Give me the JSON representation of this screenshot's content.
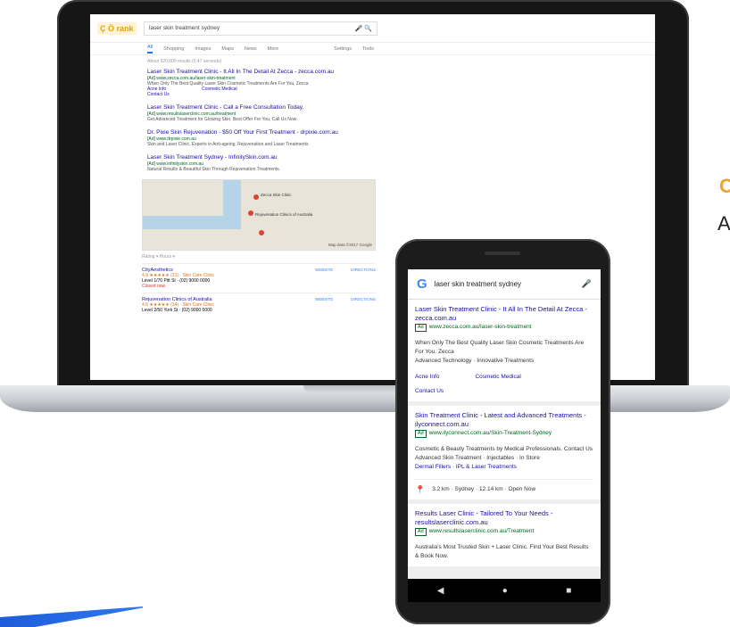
{
  "desktop": {
    "logo": "Ç Ö rank",
    "query": "laser skin treatment sydney",
    "tabs": [
      "All",
      "Shopping",
      "Images",
      "Maps",
      "News",
      "More",
      "Settings",
      "Tools"
    ],
    "stats": "About 920,000 results (0.47 seconds)",
    "results": [
      {
        "title": "Laser Skin Treatment Clinic - It All In The Detail At Zecca - zecca.com.au",
        "url": "[Ad] www.zecca.com.au/laser-skin-treatment",
        "desc": "When Only The Best Quality Laser Skin Cosmetic Treatments Are For You. Zecca",
        "link1": "Acne Info",
        "link2": "Cosmetic Medical",
        "link3": "Contact Us"
      },
      {
        "title": "Laser Skin Treatment Clinic - Call a Free Consultation Today.",
        "url": "[Ad] www.resultslaserclinic.com.au/treatment",
        "desc": "Get Advanced Treatment for Glowing Skin. Best Offer For You. Call Us Now",
        "link1": "",
        "link2": "",
        "link3": ""
      },
      {
        "title": "Dr. Pixie Skin Rejuvenation - $50 Off Your First Treatment - drpixie.com.au",
        "url": "[Ad] www.drpixie.com.au",
        "desc": "Skin and Laser Clinic. Experts in Anti-ageing, Rejuvenation and Laser Treatments.",
        "link1": "",
        "link2": "",
        "link3": ""
      },
      {
        "title": "Laser Skin Treatment Sydney - InfinitySkin.com.au",
        "url": "[Ad] www.infinityskin.com.au",
        "desc": "Natural Results & Beautiful Skin Through Rejuvenation Treatments.",
        "link1": "",
        "link2": "",
        "link3": ""
      }
    ],
    "map_labels": [
      "Zecca Skin Clinic",
      "Rejuvenation Clinics of Australia"
    ],
    "map_footer": "Map data ©2017 Google",
    "local_head": "Rating ▾  Hours ▾",
    "locals": [
      {
        "name": "CityAesthetics",
        "stars": "4.9 ★★★★★ (21) · Skin Care Clinic",
        "addr": "Level 1/70 Pitt St · (02) 9000 0000",
        "status": "Closed now",
        "a1": "WEBSITE",
        "a2": "DIRECTIONS"
      },
      {
        "name": "Rejuvenation Clinics of Australia",
        "stars": "4.8 ★★★★★ (34) · Skin Care Clinic",
        "addr": "Level 2/50 York St · (02) 9000 0000",
        "status": "Open until 7:00 PM",
        "a1": "WEBSITE",
        "a2": "DIRECTIONS"
      }
    ]
  },
  "mobile": {
    "query": "laser skin treatment sydney",
    "cards": [
      {
        "title": "Laser Skin Treatment Clinic - It All In The Detail At Zecca - zecca.com.au",
        "url": "www.zecca.com.au/laser-skin-treatment",
        "desc": "When Only The Best Quality Laser Skin Cosmetic Treatments Are For You. Zecca",
        "desc2": "Advanced Technology · Innovative Treatments",
        "link_left": "Acne Info",
        "link_right": "Cosmetic Medical",
        "link_bottom": "Contact Us",
        "loc": ""
      },
      {
        "title": "Skin Treatment Clinic - Latest and Advanced Treatments - ilyconnect.com.au",
        "url": "www.ilyconnect.com.au/Skin-Treatment-Sydney",
        "desc": "Cosmetic & Beauty Treatments by Medical Professionals. Contact Us",
        "desc2": "Advanced Skin Treatment · Injectables · In Store",
        "link_bottom": "Dermal Fillers · IPL & Laser Treatments",
        "link_left": "",
        "link_right": "",
        "loc": "3.2 km · Sydney · 12.14 km · Open Now"
      },
      {
        "title": "Results Laser Clinic - Tailored To Your Needs - resultslaserclinic.com.au",
        "url": "www.resultslaserclinic.com.au/Treatment",
        "desc": "Australia's Most Trusted Skin + Laser Clinic. Find Your Best Results & Book Now.",
        "desc2": "",
        "link_left": "",
        "link_right": "",
        "link_bottom": "",
        "loc": ""
      }
    ],
    "nav": [
      "◀",
      "●",
      "■"
    ]
  },
  "edge": {
    "c": "C",
    "a": "A"
  }
}
